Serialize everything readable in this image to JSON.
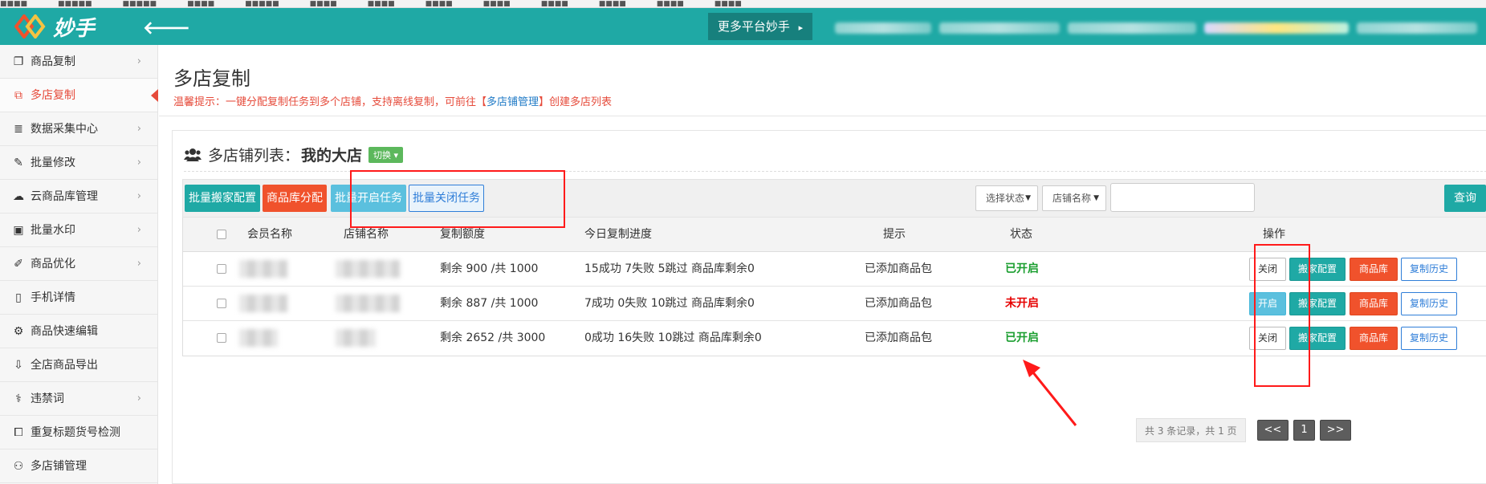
{
  "app": {
    "brand": "妙手",
    "more_platforms": "更多平台妙手",
    "more_arrow": "▸",
    "back_arrow": "🡐"
  },
  "sidebar": {
    "items": [
      {
        "label": "商品复制",
        "icon": "copy-icon",
        "glyph": "❐",
        "chevron": true
      },
      {
        "label": "多店复制",
        "icon": "multi-copy-icon",
        "glyph": "⧉",
        "chevron": false,
        "active": true
      },
      {
        "label": "数据采集中心",
        "icon": "database-icon",
        "glyph": "≣",
        "chevron": true
      },
      {
        "label": "批量修改",
        "icon": "edit-icon",
        "glyph": "✎",
        "chevron": true
      },
      {
        "label": "云商品库管理",
        "icon": "cloud-icon",
        "glyph": "☁",
        "chevron": true
      },
      {
        "label": "批量水印",
        "icon": "image-icon",
        "glyph": "▣",
        "chevron": true
      },
      {
        "label": "商品优化",
        "icon": "magic-wand-icon",
        "glyph": "✐",
        "chevron": true
      },
      {
        "label": "手机详情",
        "icon": "mobile-icon",
        "glyph": "▯",
        "chevron": false
      },
      {
        "label": "商品快速编辑",
        "icon": "gears-icon",
        "glyph": "⚙",
        "chevron": false
      },
      {
        "label": "全店商品导出",
        "icon": "cloud-download-icon",
        "glyph": "⇩",
        "chevron": false
      },
      {
        "label": "违禁词",
        "icon": "stethoscope-icon",
        "glyph": "⚕",
        "chevron": true
      },
      {
        "label": "重复标题货号检测",
        "icon": "duplicate-icon",
        "glyph": "⧠",
        "chevron": false
      },
      {
        "label": "多店铺管理",
        "icon": "users-icon",
        "glyph": "⚇",
        "chevron": false
      }
    ],
    "chevron_glyph": "›"
  },
  "page": {
    "title": "多店复制",
    "tip_prefix": "温馨提示：一键分配复制任务到多个店铺，支持离线复制，可前往【",
    "tip_link": "多店铺管理",
    "tip_suffix": "】创建多店列表"
  },
  "panel": {
    "head_label": "多店铺列表：",
    "current_store": "我的大店",
    "switch_label": "切换 ▾"
  },
  "toolbar": {
    "batch_move_config": "批量搬家配置",
    "lib_distribute": "商品库分配",
    "batch_open": "批量开启任务",
    "batch_close": "批量关闭任务",
    "status_select": "选择状态",
    "store_select": "店铺名称",
    "search_value": "",
    "query": "查询",
    "caret": "▼"
  },
  "table": {
    "headers": {
      "member": "会员名称",
      "store": "店铺名称",
      "quota": "复制额度",
      "progress": "今日复制进度",
      "hint": "提示",
      "status": "状态",
      "actions": "操作"
    },
    "rows": [
      {
        "quota": "剩余 900 /共 1000",
        "progress": "15成功 7失败 5跳过 商品库剩余0",
        "hint": "已添加商品包",
        "status": "已开启",
        "status_on": true,
        "toggle": "关闭"
      },
      {
        "quota": "剩余 887 /共 1000",
        "progress": "7成功 0失败 10跳过 商品库剩余0",
        "hint": "已添加商品包",
        "status": "未开启",
        "status_on": false,
        "toggle": "开启"
      },
      {
        "quota": "剩余 2652 /共 3000",
        "progress": "0成功 16失败 10跳过 商品库剩余0",
        "hint": "已添加商品包",
        "status": "已开启",
        "status_on": true,
        "toggle": "关闭"
      }
    ],
    "action_labels": {
      "move_config": "搬家配置",
      "lib": "商品库",
      "history": "复制历史"
    }
  },
  "pager": {
    "info": "共 3 条记录，共 1 页",
    "prev": "<<",
    "page": "1",
    "next": ">>"
  },
  "colors": {
    "brand_teal": "#1fa9a5",
    "danger_red": "#e64b3b",
    "status_on": "#1a9e2f",
    "status_off": "#e60000",
    "annotation_red": "#ff1a1a"
  }
}
